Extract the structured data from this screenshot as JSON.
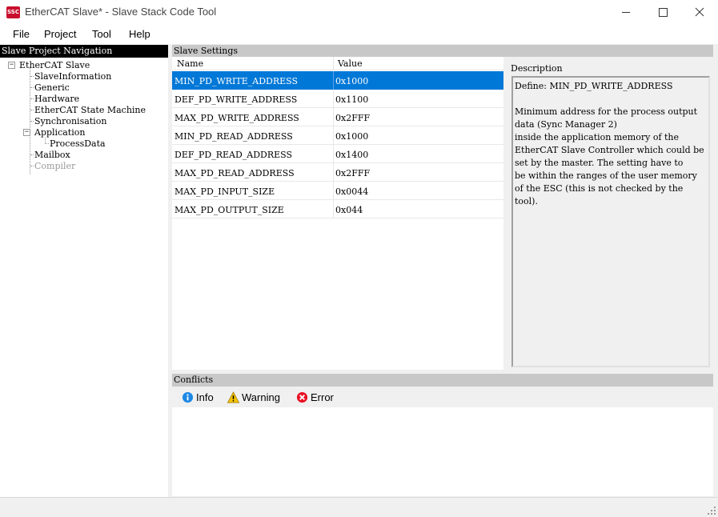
{
  "window": {
    "icon_text": "SSC",
    "title": "EtherCAT Slave* - Slave Stack Code Tool"
  },
  "menu": {
    "file": "File",
    "project": "Project",
    "tool": "Tool",
    "help": "Help"
  },
  "nav": {
    "header": "Slave Project Navigation",
    "root": "EtherCAT Slave",
    "items": {
      "slave_information": "SlaveInformation",
      "generic": "Generic",
      "hardware": "Hardware",
      "state_machine": "EtherCAT State Machine",
      "synchronisation": "Synchronisation",
      "application": "Application",
      "process_data": "ProcessData",
      "mailbox": "Mailbox",
      "compiler": "Compiler"
    }
  },
  "settings": {
    "header": "Slave Settings",
    "columns": {
      "name": "Name",
      "value": "Value"
    },
    "rows": [
      {
        "name": "MIN_PD_WRITE_ADDRESS",
        "value": "0x1000",
        "selected": true
      },
      {
        "name": "DEF_PD_WRITE_ADDRESS",
        "value": "0x1100"
      },
      {
        "name": "MAX_PD_WRITE_ADDRESS",
        "value": "0x2FFF"
      },
      {
        "name": "MIN_PD_READ_ADDRESS",
        "value": "0x1000"
      },
      {
        "name": "DEF_PD_READ_ADDRESS",
        "value": "0x1400"
      },
      {
        "name": "MAX_PD_READ_ADDRESS",
        "value": "0x2FFF"
      },
      {
        "name": "MAX_PD_INPUT_SIZE",
        "value": "0x0044"
      },
      {
        "name": "MAX_PD_OUTPUT_SIZE",
        "value": "0x044"
      }
    ]
  },
  "description": {
    "label": "Description",
    "lines": [
      "Define: MIN_PD_WRITE_ADDRESS",
      "",
      "Minimum address for the process output",
      "data (Sync Manager 2)",
      "inside the application memory of the",
      "EtherCAT Slave Controller which could be",
      "set by the master. The setting have to",
      "be within the ranges of the user memory",
      "of the ESC (this is not checked by the",
      "tool)."
    ]
  },
  "conflicts": {
    "header": "Conflicts",
    "info": "Info",
    "warning": "Warning",
    "error": "Error"
  },
  "colors": {
    "selection": "#0078d7",
    "error": "#e81123",
    "warning": "#f5c400",
    "info": "#1e88e5"
  }
}
